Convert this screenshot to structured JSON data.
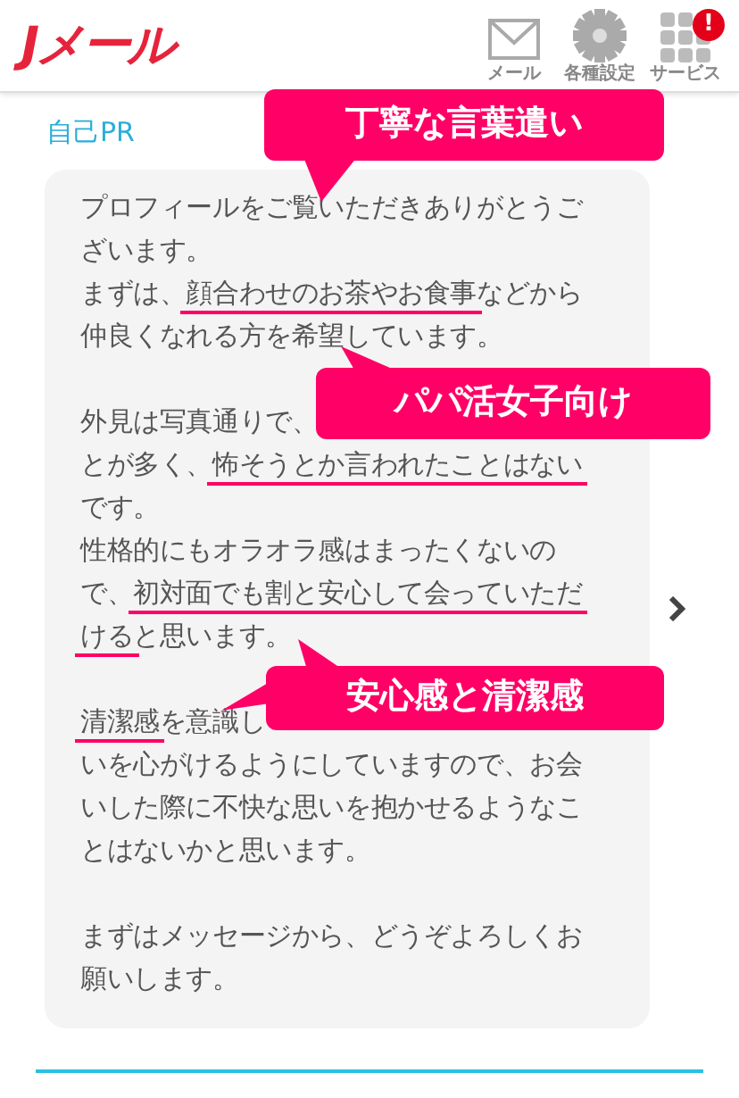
{
  "header": {
    "logo": "Jメール",
    "nav": [
      {
        "kind": "mail",
        "label": "メール"
      },
      {
        "kind": "settings",
        "label": "各種設定"
      },
      {
        "kind": "services",
        "label": "サービス",
        "badge": "!"
      }
    ]
  },
  "section": {
    "title": "自己PR",
    "paragraphs": [
      [
        [
          {
            "text": "プロフィールをご覧いただきありがとうご",
            "underlined": false
          }
        ],
        [
          {
            "text": "ざいます。",
            "underlined": false
          }
        ],
        [
          {
            "text": "まずは、",
            "underlined": false
          },
          {
            "text": "顔合わせのお茶やお食事",
            "underlined": true
          },
          {
            "text": "などから",
            "underlined": false
          }
        ],
        [
          {
            "text": "仲良くなれる方を希望しています。",
            "underlined": false
          }
        ]
      ],
      [
        [
          {
            "text": "外見は写真通りで、",
            "underlined": false
          }
        ],
        [
          {
            "text": "とが多く、",
            "underlined": false
          },
          {
            "text": "怖そうとか言われたことはない",
            "underlined": true
          }
        ],
        [
          {
            "text": "です。",
            "underlined": false
          }
        ],
        [
          {
            "text": "性格的にもオラオラ感はまったくないの",
            "underlined": false
          }
        ],
        [
          {
            "text": "で、",
            "underlined": false
          },
          {
            "text": "初対面でも割と安心して会っていただ",
            "underlined": true
          }
        ],
        [
          {
            "text": "ける",
            "underlined": true
          },
          {
            "text": "と思います。",
            "underlined": false
          }
        ]
      ],
      [
        [
          {
            "text": "清潔感",
            "underlined": true
          },
          {
            "text": "を意識し",
            "underlined": false
          }
        ],
        [
          {
            "text": "いを心がけるようにしていますので、お会",
            "underlined": false
          }
        ],
        [
          {
            "text": "いした際に不快な思いを抱かせるようなこ",
            "underlined": false
          }
        ],
        [
          {
            "text": "とはないかと思います。",
            "underlined": false
          }
        ]
      ],
      [
        [
          {
            "text": "まずはメッセージから、どうぞよろしくお",
            "underlined": false
          }
        ],
        [
          {
            "text": "願いします。",
            "underlined": false
          }
        ]
      ]
    ]
  },
  "callouts": [
    {
      "text": "丁寧な言葉遣い"
    },
    {
      "text": "パパ活女子向け"
    },
    {
      "text": "安心感と清潔感"
    }
  ]
}
